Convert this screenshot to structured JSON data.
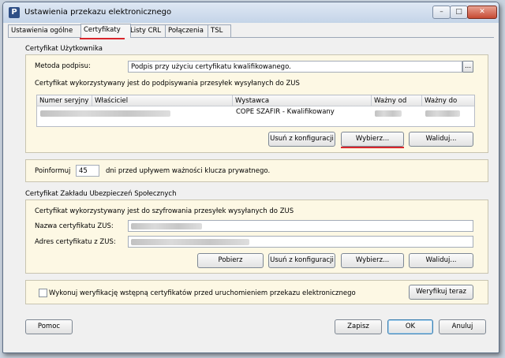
{
  "window": {
    "title": "Ustawienia przekazu elektronicznego",
    "app_icon": "P",
    "controls": {
      "minimize": "–",
      "maximize": "□",
      "close": "✕"
    }
  },
  "tabs": [
    {
      "label": "Ustawienia ogólne"
    },
    {
      "label": "Certyfikaty",
      "active": true
    },
    {
      "label": "Listy CRL"
    },
    {
      "label": "Połączenia"
    },
    {
      "label": "TSL"
    }
  ],
  "user_cert": {
    "group_label": "Certyfikat Użytkownika",
    "method_label": "Metoda podpisu:",
    "method_value": "Podpis przy użyciu certyfikatu kwalifikowanego.",
    "ellipsis": "...",
    "description": "Certyfikat wykorzystywany jest do podpisywania przesyłek wysyłanych do ZUS",
    "table": {
      "headers": [
        "Numer seryjny",
        "/",
        "Właściciel",
        "Wystawca",
        "Ważny od",
        "Ważny do"
      ],
      "row": {
        "issuer": "COPE SZAFIR - Kwalifikowany"
      }
    },
    "buttons": {
      "remove": "Usuń z konfiguracji",
      "select": "Wybierz...",
      "validate": "Waliduj..."
    }
  },
  "notify": {
    "prefix": "Poinformuj",
    "days_value": "45",
    "suffix": "dni przed upływem ważności klucza prywatnego."
  },
  "zus_cert": {
    "group_label": "Certyfikat Zakładu Ubezpieczeń Społecznych",
    "description": "Certyfikat wykorzystywany jest do szyfrowania przesyłek wysyłanych do ZUS",
    "name_label": "Nazwa certyfikatu ZUS:",
    "address_label": "Adres certyfikatu z ZUS:",
    "buttons": {
      "fetch": "Pobierz",
      "remove": "Usuń z konfiguracji",
      "select": "Wybierz...",
      "validate": "Waliduj..."
    }
  },
  "verify": {
    "checkbox_label": "Wykonuj weryfikację wstępną certyfikatów przed uruchomieniem przekazu elektronicznego",
    "checked": false,
    "button": "Weryfikuj teraz"
  },
  "footer": {
    "help": "Pomoc",
    "save": "Zapisz",
    "ok": "OK",
    "cancel": "Anuluj"
  },
  "colors": {
    "panel": "#fdf8e4",
    "highlight": "#d9262c",
    "window": "#f0f0f0"
  }
}
